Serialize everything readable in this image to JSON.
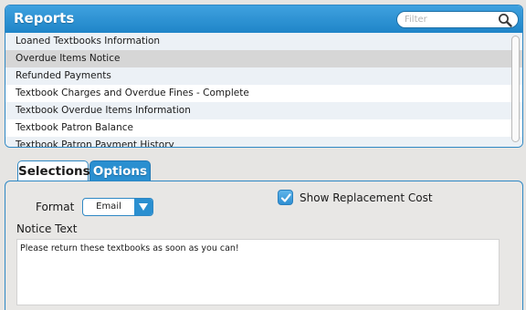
{
  "reports": {
    "title": "Reports",
    "filter": {
      "placeholder": "Filter",
      "value": ""
    },
    "items": [
      {
        "label": "Loaned Textbooks Information",
        "selected": false
      },
      {
        "label": "Overdue Items Notice",
        "selected": true
      },
      {
        "label": "Refunded Payments",
        "selected": false
      },
      {
        "label": "Textbook Charges and Overdue Fines - Complete",
        "selected": false
      },
      {
        "label": "Textbook Overdue Items Information",
        "selected": false
      },
      {
        "label": "Textbook Patron Balance",
        "selected": false
      },
      {
        "label": "Textbook Patron Payment History",
        "selected": false
      }
    ]
  },
  "tabs": [
    {
      "label": "Selections",
      "active": false
    },
    {
      "label": "Options",
      "active": true
    }
  ],
  "options": {
    "format_label": "Format",
    "format_value": "Email",
    "show_replacement_cost": {
      "label": "Show Replacement Cost",
      "checked": true
    },
    "notice_label": "Notice Text",
    "notice_text": "Please return these textbooks as soon as you can!"
  },
  "colors": {
    "accent": "#2a8fd0",
    "header_blue": "#3fa1df",
    "selected_row": "#d6d6d6",
    "alt_row": "#ecf1f6"
  },
  "icons": [
    "search-icon",
    "chevron-down-icon",
    "checkmark-icon"
  ]
}
